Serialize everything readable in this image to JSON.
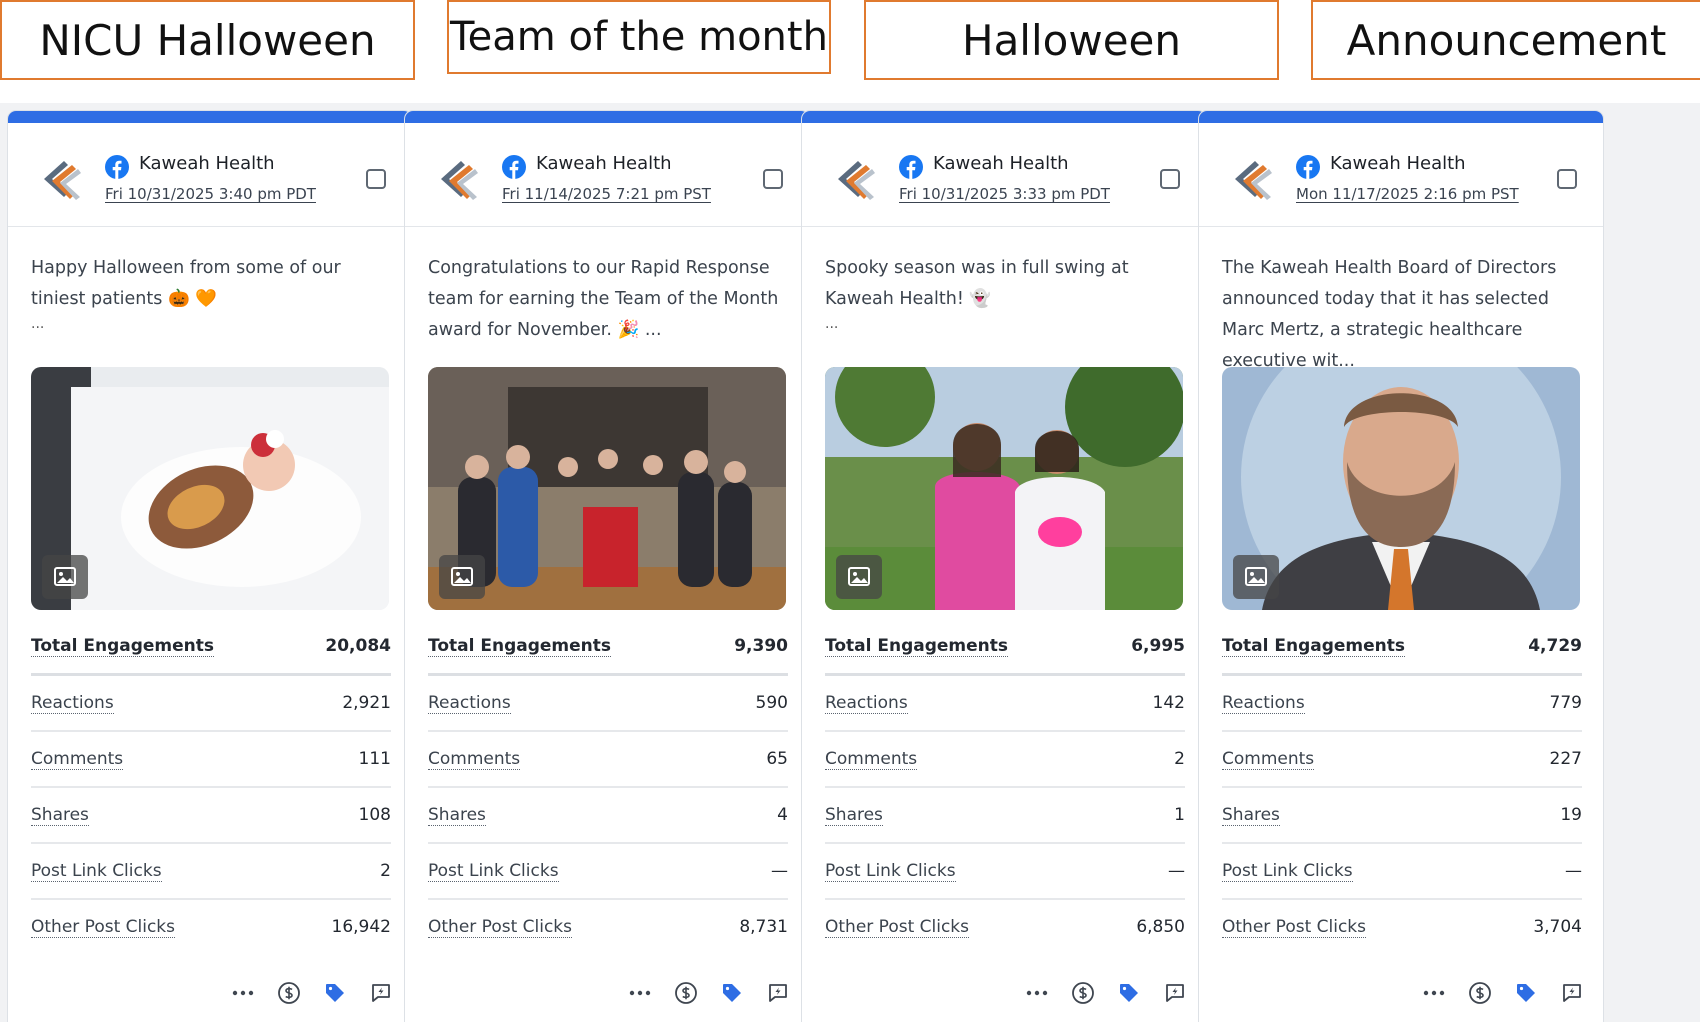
{
  "section_labels": [
    "NICU Halloween",
    "Team of the month",
    "Halloween",
    "Announcement"
  ],
  "posts": [
    {
      "account": "Kaweah Health",
      "timestamp": "Fri 10/31/2025 3:40 pm PDT",
      "caption": "Happy Halloween from some of our tiniest patients 🎃 🧡",
      "caption_more": "...",
      "image_icon": "baby-photo",
      "metrics": {
        "total_engagements_label": "Total Engagements",
        "total_engagements": "20,084",
        "reactions_label": "Reactions",
        "reactions": "2,921",
        "comments_label": "Comments",
        "comments": "111",
        "shares_label": "Shares",
        "shares": "108",
        "post_link_clicks_label": "Post Link Clicks",
        "post_link_clicks": "2",
        "other_post_clicks_label": "Other Post Clicks",
        "other_post_clicks": "16,942"
      }
    },
    {
      "account": "Kaweah Health",
      "timestamp": "Fri 11/14/2025 7:21 pm PST",
      "caption": "Congratulations to our Rapid Response team for earning the Team of the Month award for November. 🎉 ...",
      "caption_more": "",
      "image_icon": "team-photo",
      "metrics": {
        "total_engagements_label": "Total Engagements",
        "total_engagements": "9,390",
        "reactions_label": "Reactions",
        "reactions": "590",
        "comments_label": "Comments",
        "comments": "65",
        "shares_label": "Shares",
        "shares": "4",
        "post_link_clicks_label": "Post Link Clicks",
        "post_link_clicks": "—",
        "other_post_clicks_label": "Other Post Clicks",
        "other_post_clicks": "8,731"
      }
    },
    {
      "account": "Kaweah Health",
      "timestamp": "Fri 10/31/2025 3:33 pm PDT",
      "caption": "Spooky season was in full swing at Kaweah Health! 👻",
      "caption_more": "...",
      "image_icon": "costume-photo",
      "metrics": {
        "total_engagements_label": "Total Engagements",
        "total_engagements": "6,995",
        "reactions_label": "Reactions",
        "reactions": "142",
        "comments_label": "Comments",
        "comments": "2",
        "shares_label": "Shares",
        "shares": "1",
        "post_link_clicks_label": "Post Link Clicks",
        "post_link_clicks": "—",
        "other_post_clicks_label": "Other Post Clicks",
        "other_post_clicks": "6,850"
      }
    },
    {
      "account": "Kaweah Health",
      "timestamp": "Mon 11/17/2025 2:16 pm PST",
      "caption": "The Kaweah Health Board of Directors announced today that it has selected Marc Mertz, a strategic healthcare executive wit...",
      "caption_more": "",
      "image_icon": "portrait-photo",
      "metrics": {
        "total_engagements_label": "Total Engagements",
        "total_engagements": "4,729",
        "reactions_label": "Reactions",
        "reactions": "779",
        "comments_label": "Comments",
        "comments": "227",
        "shares_label": "Shares",
        "shares": "19",
        "post_link_clicks_label": "Post Link Clicks",
        "post_link_clicks": "—",
        "other_post_clicks_label": "Other Post Clicks",
        "other_post_clicks": "3,704"
      }
    }
  ],
  "action_icons": [
    "more-icon",
    "dollar-icon",
    "tag-icon",
    "comment-bolt-icon"
  ],
  "colors": {
    "accent": "#2e6de4",
    "label_border": "#e07a2f",
    "facebook": "#1877f2"
  }
}
